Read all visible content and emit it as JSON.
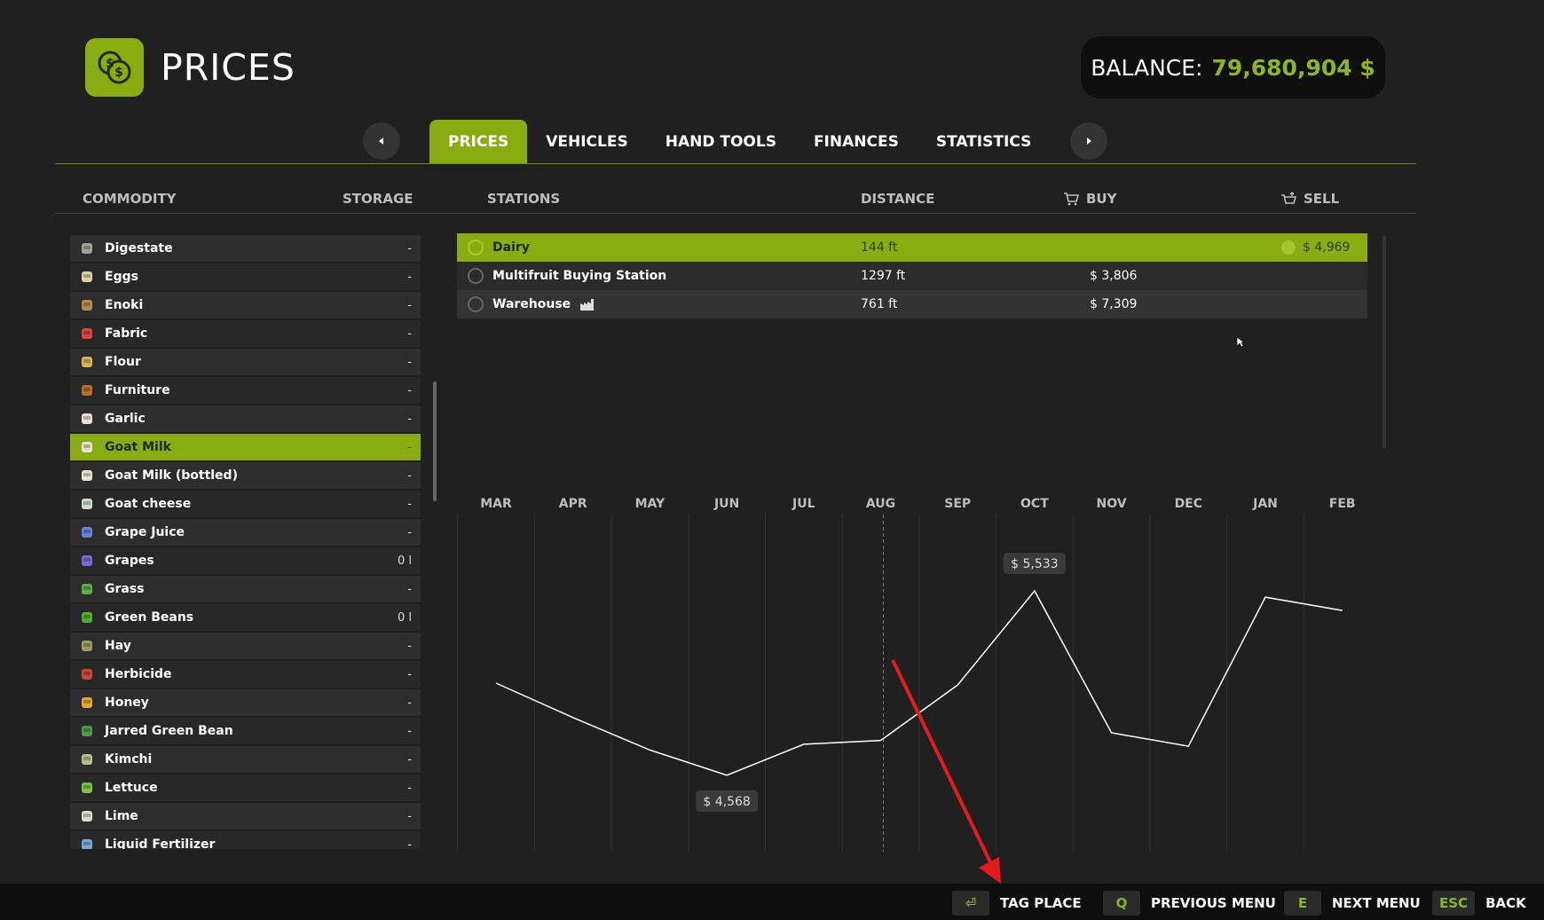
{
  "header": {
    "title": "PRICES",
    "balance_label": "BALANCE:",
    "balance_value": "79,680,904 $"
  },
  "tabs": [
    {
      "label": "PRICES",
      "active": true
    },
    {
      "label": "VEHICLES",
      "active": false
    },
    {
      "label": "HAND TOOLS",
      "active": false
    },
    {
      "label": "FINANCES",
      "active": false
    },
    {
      "label": "STATISTICS",
      "active": false
    }
  ],
  "columns": {
    "commodity": "COMMODITY",
    "storage": "STORAGE",
    "stations": "STATIONS",
    "distance": "DISTANCE",
    "buy": "BUY",
    "sell": "SELL"
  },
  "commodities": [
    {
      "name": "Digestate",
      "storage": "-",
      "icon": "digestate-icon"
    },
    {
      "name": "Eggs",
      "storage": "-",
      "icon": "eggs-icon"
    },
    {
      "name": "Enoki",
      "storage": "-",
      "icon": "enoki-icon"
    },
    {
      "name": "Fabric",
      "storage": "-",
      "icon": "fabric-icon"
    },
    {
      "name": "Flour",
      "storage": "-",
      "icon": "flour-icon"
    },
    {
      "name": "Furniture",
      "storage": "-",
      "icon": "furniture-icon"
    },
    {
      "name": "Garlic",
      "storage": "-",
      "icon": "garlic-icon"
    },
    {
      "name": "Goat Milk",
      "storage": "-",
      "icon": "goat-milk-icon",
      "selected": true
    },
    {
      "name": "Goat Milk (bottled)",
      "storage": "-",
      "icon": "bottled-goat-milk-icon"
    },
    {
      "name": "Goat cheese",
      "storage": "-",
      "icon": "goat-cheese-icon"
    },
    {
      "name": "Grape Juice",
      "storage": "-",
      "icon": "grape-juice-icon"
    },
    {
      "name": "Grapes",
      "storage": "0 l",
      "icon": "grapes-icon"
    },
    {
      "name": "Grass",
      "storage": "-",
      "icon": "grass-icon"
    },
    {
      "name": "Green Beans",
      "storage": "0 l",
      "icon": "green-beans-icon"
    },
    {
      "name": "Hay",
      "storage": "-",
      "icon": "hay-icon"
    },
    {
      "name": "Herbicide",
      "storage": "-",
      "icon": "herbicide-icon"
    },
    {
      "name": "Honey",
      "storage": "-",
      "icon": "honey-icon"
    },
    {
      "name": "Jarred Green Bean",
      "storage": "-",
      "icon": "jarred-green-bean-icon"
    },
    {
      "name": "Kimchi",
      "storage": "-",
      "icon": "kimchi-icon"
    },
    {
      "name": "Lettuce",
      "storage": "-",
      "icon": "lettuce-icon"
    },
    {
      "name": "Lime",
      "storage": "-",
      "icon": "lime-icon"
    },
    {
      "name": "Liquid Fertilizer",
      "storage": "-",
      "icon": "liquid-fertilizer-icon"
    }
  ],
  "stations": [
    {
      "name": "Dairy",
      "distance": "144 ft",
      "buy": "",
      "sell": "$ 4,969",
      "selected": true
    },
    {
      "name": "Multifruit Buying Station",
      "distance": "1297 ft",
      "buy": "$ 3,806",
      "sell": ""
    },
    {
      "name": "Warehouse",
      "distance": "761 ft",
      "buy": "$ 7,309",
      "sell": "",
      "factory_icon": true
    }
  ],
  "chart_data": {
    "type": "line",
    "categories": [
      "MAR",
      "APR",
      "MAY",
      "JUN",
      "JUL",
      "AUG",
      "SEP",
      "OCT",
      "NOV",
      "DEC",
      "JAN",
      "FEB"
    ],
    "values": [
      5050,
      4870,
      4700,
      4568,
      4730,
      4750,
      5040,
      5533,
      4790,
      4720,
      5500,
      5430
    ],
    "ylim": [
      4400,
      5700
    ],
    "current_month": "AUG",
    "annotations": [
      {
        "category": "OCT",
        "label": "$ 5,533",
        "position": "above"
      },
      {
        "category": "JUN",
        "label": "$ 4,568",
        "position": "below"
      }
    ],
    "line_color": "#ffffff",
    "grid": "vertical"
  },
  "hints": [
    {
      "key": "⏎",
      "label": "TAG PLACE"
    },
    {
      "key": "Q",
      "label": "PREVIOUS MENU"
    },
    {
      "key": "E",
      "label": "NEXT MENU"
    },
    {
      "key": "ESC",
      "label": "BACK"
    }
  ],
  "colors": {
    "accent": "#8aac13",
    "balance": "#8cb526",
    "background": "#202020",
    "annotation_arrow": "#e31b1b"
  }
}
